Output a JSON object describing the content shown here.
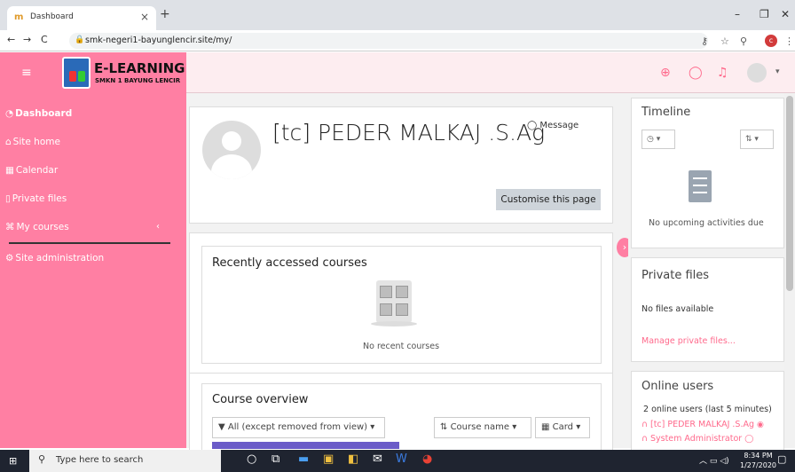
{
  "browser": {
    "tab_title": "Dashboard",
    "tab_close": "×",
    "new_tab": "+",
    "url": "smk-negeri1-bayunglencir.site/my/",
    "win_minimize": "–",
    "win_restore": "❐",
    "win_close": "✕",
    "profile_initial": "c"
  },
  "header": {
    "brand_title": "E-LEARNING",
    "brand_subtitle": "SMKN 1 BAYUNG LENCIR"
  },
  "sidebar": {
    "items": [
      {
        "label": "Dashboard"
      },
      {
        "label": "Site home"
      },
      {
        "label": "Calendar"
      },
      {
        "label": "Private files"
      },
      {
        "label": "My courses"
      },
      {
        "label": "Site administration"
      }
    ]
  },
  "profile": {
    "name": "[tc] PEDER MALKAJ .S.Ag",
    "message_label": "Message",
    "customise_label": "Customise this page"
  },
  "recent": {
    "title": "Recently accessed courses",
    "empty": "No recent courses"
  },
  "overview": {
    "title": "Course overview",
    "filter": "All (except removed from view)",
    "sort": "Course name",
    "view": "Card"
  },
  "timeline": {
    "title": "Timeline",
    "empty": "No upcoming activities due"
  },
  "private_files": {
    "title": "Private files",
    "empty": "No files available",
    "manage": "Manage private files..."
  },
  "online_users": {
    "title": "Online users",
    "count": "2 online users (last 5 minutes)",
    "users": [
      {
        "name": "[tc] PEDER MALKAJ .S.Ag"
      },
      {
        "name": "System Administrator"
      }
    ]
  },
  "taskbar": {
    "search_placeholder": "Type here to search",
    "time": "8:34 PM",
    "date": "1/27/2020"
  },
  "colors": {
    "accent": "#ff7fa3",
    "navbar_bg": "#fdedf0"
  }
}
